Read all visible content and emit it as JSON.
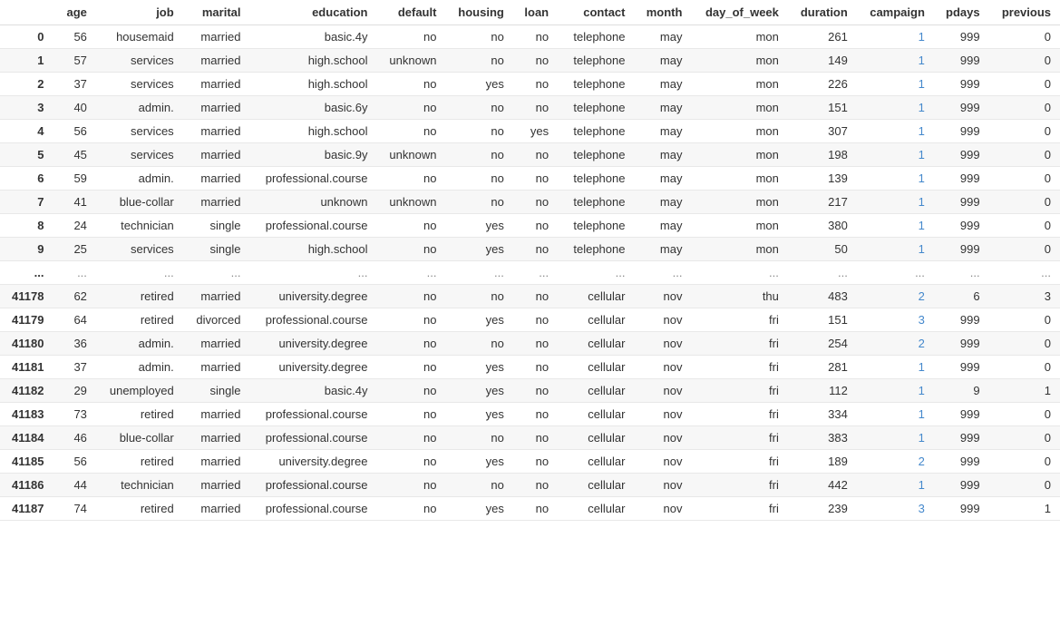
{
  "table": {
    "headers": [
      "",
      "age",
      "job",
      "marital",
      "education",
      "default",
      "housing",
      "loan",
      "contact",
      "month",
      "day_of_week",
      "duration",
      "campaign",
      "pdays",
      "previous"
    ],
    "rows": [
      [
        "0",
        "56",
        "housemaid",
        "married",
        "basic.4y",
        "no",
        "no",
        "no",
        "telephone",
        "may",
        "mon",
        "261",
        "1",
        "999",
        "0"
      ],
      [
        "1",
        "57",
        "services",
        "married",
        "high.school",
        "unknown",
        "no",
        "no",
        "telephone",
        "may",
        "mon",
        "149",
        "1",
        "999",
        "0"
      ],
      [
        "2",
        "37",
        "services",
        "married",
        "high.school",
        "no",
        "yes",
        "no",
        "telephone",
        "may",
        "mon",
        "226",
        "1",
        "999",
        "0"
      ],
      [
        "3",
        "40",
        "admin.",
        "married",
        "basic.6y",
        "no",
        "no",
        "no",
        "telephone",
        "may",
        "mon",
        "151",
        "1",
        "999",
        "0"
      ],
      [
        "4",
        "56",
        "services",
        "married",
        "high.school",
        "no",
        "no",
        "yes",
        "telephone",
        "may",
        "mon",
        "307",
        "1",
        "999",
        "0"
      ],
      [
        "5",
        "45",
        "services",
        "married",
        "basic.9y",
        "unknown",
        "no",
        "no",
        "telephone",
        "may",
        "mon",
        "198",
        "1",
        "999",
        "0"
      ],
      [
        "6",
        "59",
        "admin.",
        "married",
        "professional.course",
        "no",
        "no",
        "no",
        "telephone",
        "may",
        "mon",
        "139",
        "1",
        "999",
        "0"
      ],
      [
        "7",
        "41",
        "blue-collar",
        "married",
        "unknown",
        "unknown",
        "no",
        "no",
        "telephone",
        "may",
        "mon",
        "217",
        "1",
        "999",
        "0"
      ],
      [
        "8",
        "24",
        "technician",
        "single",
        "professional.course",
        "no",
        "yes",
        "no",
        "telephone",
        "may",
        "mon",
        "380",
        "1",
        "999",
        "0"
      ],
      [
        "9",
        "25",
        "services",
        "single",
        "high.school",
        "no",
        "yes",
        "no",
        "telephone",
        "may",
        "mon",
        "50",
        "1",
        "999",
        "0"
      ],
      [
        "...",
        "...",
        "...",
        "...",
        "...",
        "...",
        "...",
        "...",
        "...",
        "...",
        "...",
        "...",
        "...",
        "...",
        "..."
      ],
      [
        "41178",
        "62",
        "retired",
        "married",
        "university.degree",
        "no",
        "no",
        "no",
        "cellular",
        "nov",
        "thu",
        "483",
        "2",
        "6",
        "3"
      ],
      [
        "41179",
        "64",
        "retired",
        "divorced",
        "professional.course",
        "no",
        "yes",
        "no",
        "cellular",
        "nov",
        "fri",
        "151",
        "3",
        "999",
        "0"
      ],
      [
        "41180",
        "36",
        "admin.",
        "married",
        "university.degree",
        "no",
        "no",
        "no",
        "cellular",
        "nov",
        "fri",
        "254",
        "2",
        "999",
        "0"
      ],
      [
        "41181",
        "37",
        "admin.",
        "married",
        "university.degree",
        "no",
        "yes",
        "no",
        "cellular",
        "nov",
        "fri",
        "281",
        "1",
        "999",
        "0"
      ],
      [
        "41182",
        "29",
        "unemployed",
        "single",
        "basic.4y",
        "no",
        "yes",
        "no",
        "cellular",
        "nov",
        "fri",
        "112",
        "1",
        "9",
        "1"
      ],
      [
        "41183",
        "73",
        "retired",
        "married",
        "professional.course",
        "no",
        "yes",
        "no",
        "cellular",
        "nov",
        "fri",
        "334",
        "1",
        "999",
        "0"
      ],
      [
        "41184",
        "46",
        "blue-collar",
        "married",
        "professional.course",
        "no",
        "no",
        "no",
        "cellular",
        "nov",
        "fri",
        "383",
        "1",
        "999",
        "0"
      ],
      [
        "41185",
        "56",
        "retired",
        "married",
        "university.degree",
        "no",
        "yes",
        "no",
        "cellular",
        "nov",
        "fri",
        "189",
        "2",
        "999",
        "0"
      ],
      [
        "41186",
        "44",
        "technician",
        "married",
        "professional.course",
        "no",
        "no",
        "no",
        "cellular",
        "nov",
        "fri",
        "442",
        "1",
        "999",
        "0"
      ],
      [
        "41187",
        "74",
        "retired",
        "married",
        "professional.course",
        "no",
        "yes",
        "no",
        "cellular",
        "nov",
        "fri",
        "239",
        "3",
        "999",
        "1"
      ]
    ],
    "ellipsis_row_index": 10
  }
}
